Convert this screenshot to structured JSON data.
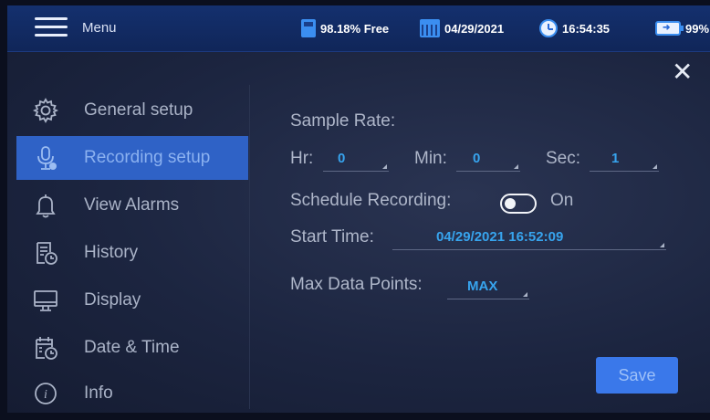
{
  "topbar": {
    "menu_label": "Menu",
    "storage": "98.18% Free",
    "date": "04/29/2021",
    "time": "16:54:35",
    "battery": "99%",
    "accent_color": "#3b8ef0"
  },
  "sidebar": {
    "items": [
      {
        "label": "General setup",
        "icon": "gear-icon"
      },
      {
        "label": "Recording setup",
        "icon": "microphone-icon",
        "active": true
      },
      {
        "label": "View Alarms",
        "icon": "bell-icon"
      },
      {
        "label": "History",
        "icon": "history-document-icon"
      },
      {
        "label": "Display",
        "icon": "monitor-icon"
      },
      {
        "label": "Date & Time",
        "icon": "calendar-clock-icon"
      },
      {
        "label": "Info",
        "icon": "info-icon"
      }
    ]
  },
  "recording": {
    "sample_rate_label": "Sample Rate:",
    "hr_label": "Hr:",
    "hr_value": "0",
    "min_label": "Min:",
    "min_value": "0",
    "sec_label": "Sec:",
    "sec_value": "1",
    "schedule_label": "Schedule Recording:",
    "schedule_state": "On",
    "start_time_label": "Start Time:",
    "start_time_value": "04/29/2021 16:52:09",
    "max_points_label": "Max Data Points:",
    "max_points_value": "MAX",
    "save_label": "Save"
  }
}
